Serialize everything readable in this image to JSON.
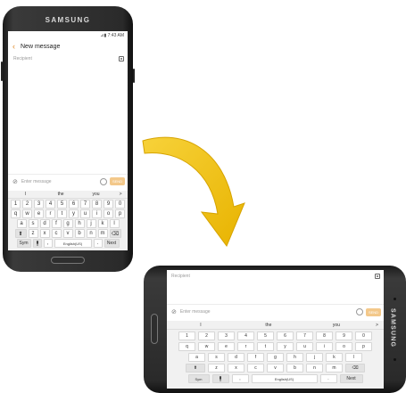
{
  "portrait": {
    "brand": "SAMSUNG",
    "status": "⊿▮ 7:43 AM",
    "header_title": "New message",
    "recipient_placeholder": "Recipient",
    "enter_placeholder": "Enter message",
    "send_label": "SEND",
    "suggestions": [
      "I",
      "the",
      "you",
      ">"
    ],
    "number_row": [
      "1",
      "2",
      "3",
      "4",
      "5",
      "6",
      "7",
      "8",
      "9",
      "0"
    ],
    "row1": [
      "q",
      "w",
      "e",
      "r",
      "t",
      "y",
      "u",
      "i",
      "o",
      "p"
    ],
    "row2": [
      "a",
      "s",
      "d",
      "f",
      "g",
      "h",
      "j",
      "k",
      "l"
    ],
    "row3": [
      "z",
      "x",
      "c",
      "v",
      "b",
      "n",
      "m"
    ],
    "sym_label": "Sym",
    "comma": ",",
    "space_label": "English(US)",
    "period": ".",
    "next_label": "Next",
    "shift_glyph": "⬆",
    "delete_glyph": "⌫",
    "mic_glyph": "🎤"
  },
  "landscape": {
    "brand": "SAMSUNG",
    "recipient_placeholder": "Recipient",
    "enter_placeholder": "Enter message",
    "send_label": "SEND",
    "suggestions": [
      "I",
      "the",
      "you",
      ">"
    ],
    "number_row": [
      "1",
      "2",
      "3",
      "4",
      "5",
      "6",
      "7",
      "8",
      "9",
      "0"
    ],
    "row1": [
      "q",
      "w",
      "e",
      "r",
      "t",
      "y",
      "u",
      "i",
      "o",
      "p"
    ],
    "row2": [
      "a",
      "s",
      "d",
      "f",
      "g",
      "h",
      "j",
      "k",
      "l"
    ],
    "row3": [
      "z",
      "x",
      "c",
      "v",
      "b",
      "n",
      "m"
    ],
    "sym_label": "Sym",
    "comma": ",",
    "space_label": "English(US)",
    "period": ".",
    "next_label": "Next",
    "shift_glyph": "⬆",
    "delete_glyph": "⌫",
    "mic_glyph": "🎤"
  },
  "colors": {
    "arrow": "#f2c20a",
    "send_disabled": "#f3c88a",
    "back_accent": "#e08a2a"
  },
  "icons": [
    "back-arrow-icon",
    "contact-icon",
    "paperclip-icon",
    "emoji-icon",
    "microphone-icon",
    "shift-icon",
    "delete-icon",
    "rotate-arrow-icon"
  ]
}
